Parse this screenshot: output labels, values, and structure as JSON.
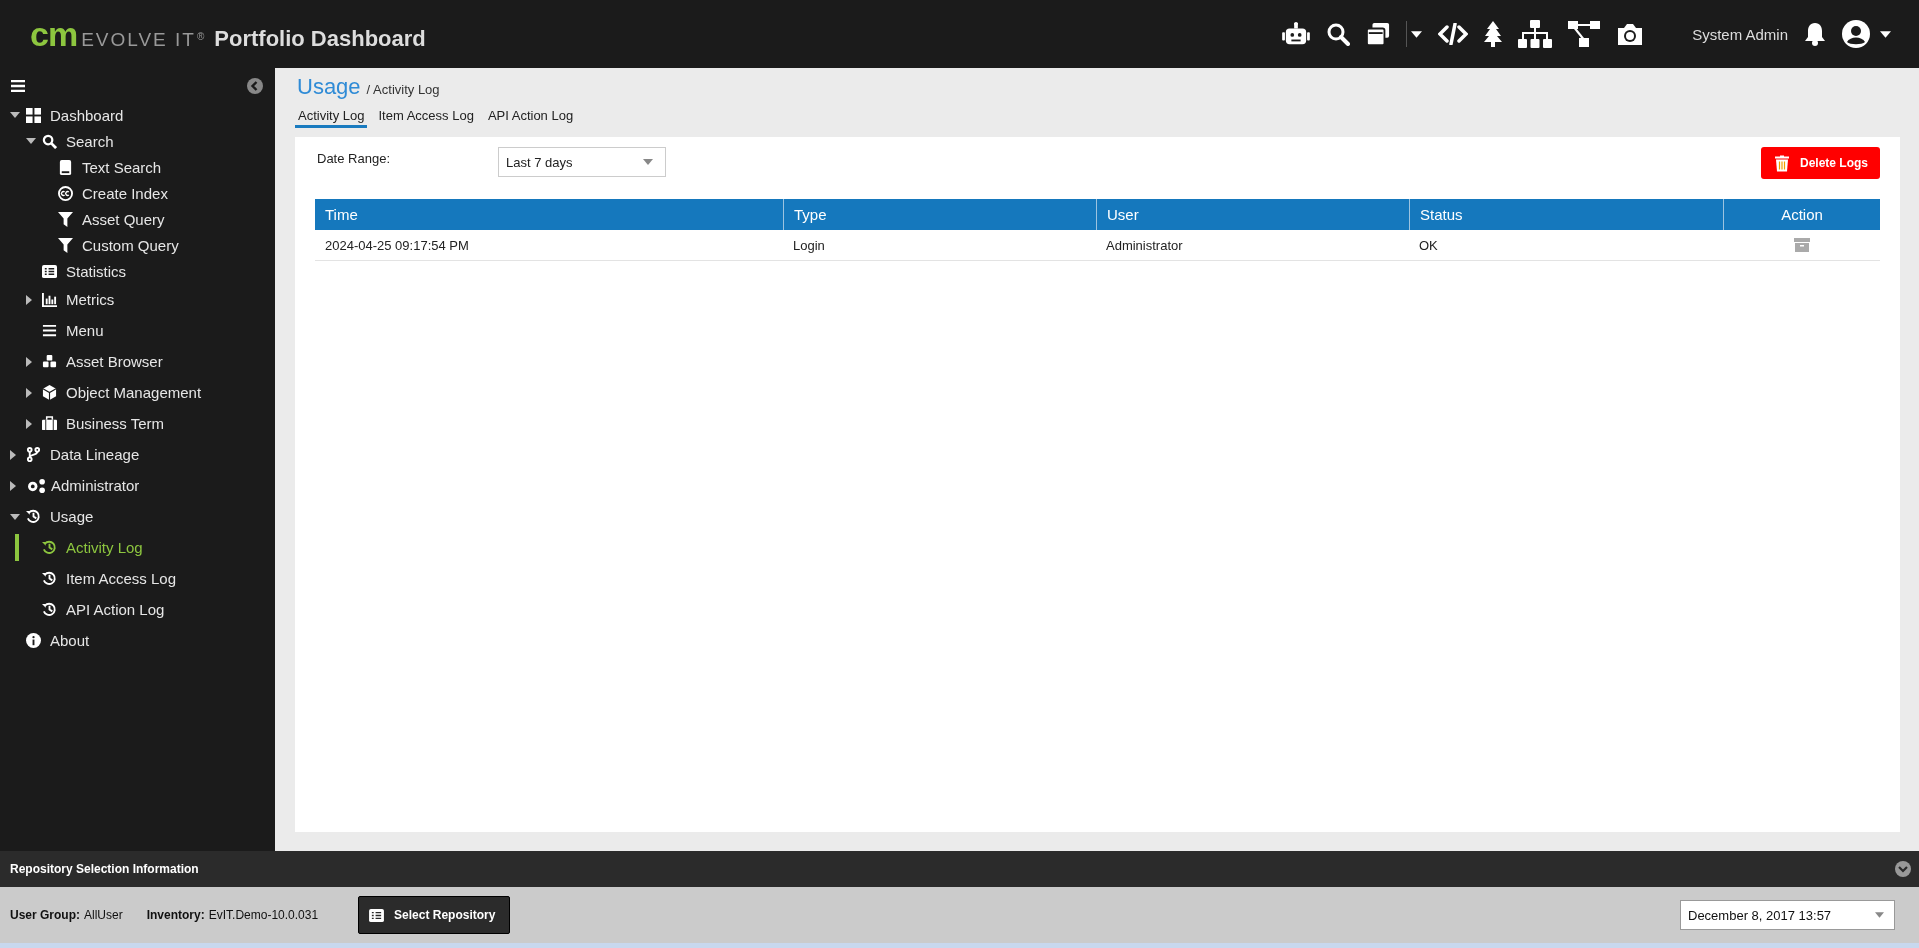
{
  "header": {
    "logo": {
      "mark": "cm",
      "name": "EVOLVE IT",
      "registered": "®"
    },
    "title": "Portfolio Dashboard",
    "user": "System Admin"
  },
  "sidebar": {
    "items": [
      {
        "label": "Dashboard",
        "expanded": true,
        "selected": false,
        "children": [
          {
            "label": "Search",
            "expanded": true,
            "selected": false,
            "children": [
              {
                "label": "Text Search",
                "selected": false
              },
              {
                "label": "Create Index",
                "selected": false
              },
              {
                "label": "Asset Query",
                "selected": false
              },
              {
                "label": "Custom Query",
                "selected": false
              }
            ]
          },
          {
            "label": "Statistics",
            "selected": false
          },
          {
            "label": "Metrics",
            "expanded": false,
            "selected": false
          },
          {
            "label": "Menu",
            "selected": false
          },
          {
            "label": "Asset Browser",
            "expanded": false,
            "selected": false
          },
          {
            "label": "Object Management",
            "expanded": false,
            "selected": false
          },
          {
            "label": "Business Term",
            "expanded": false,
            "selected": false
          }
        ]
      },
      {
        "label": "Data Lineage",
        "expanded": false,
        "selected": false
      },
      {
        "label": "Administrator",
        "expanded": false,
        "selected": false
      },
      {
        "label": "Usage",
        "expanded": true,
        "selected": false,
        "children": [
          {
            "label": "Activity Log",
            "selected": true
          },
          {
            "label": "Item Access Log",
            "selected": false
          },
          {
            "label": "API Action Log",
            "selected": false
          }
        ]
      },
      {
        "label": "About",
        "selected": false
      }
    ]
  },
  "breadcrumb": {
    "section": "Usage",
    "page": "/ Activity Log"
  },
  "tabs": [
    {
      "label": "Activity Log",
      "selected": true
    },
    {
      "label": "Item Access Log",
      "selected": false
    },
    {
      "label": "API Action Log",
      "selected": false
    }
  ],
  "filter": {
    "label": "Date Range:",
    "value": "Last 7 days"
  },
  "delete_button": "Delete Logs",
  "table": {
    "columns": [
      "Time",
      "Type",
      "User",
      "Status",
      "Action"
    ],
    "rows": [
      {
        "time": "2024-04-25 09:17:54 PM",
        "type": "Login",
        "user": "Administrator",
        "status": "OK"
      }
    ]
  },
  "footer": {
    "title": "Repository Selection Information",
    "user_group_label": "User Group:",
    "user_group": "AllUser",
    "inventory_label": "Inventory:",
    "inventory": "EvIT.Demo-10.0.031",
    "select_button": "Select Repository",
    "date": "December 8, 2017 13:57"
  }
}
